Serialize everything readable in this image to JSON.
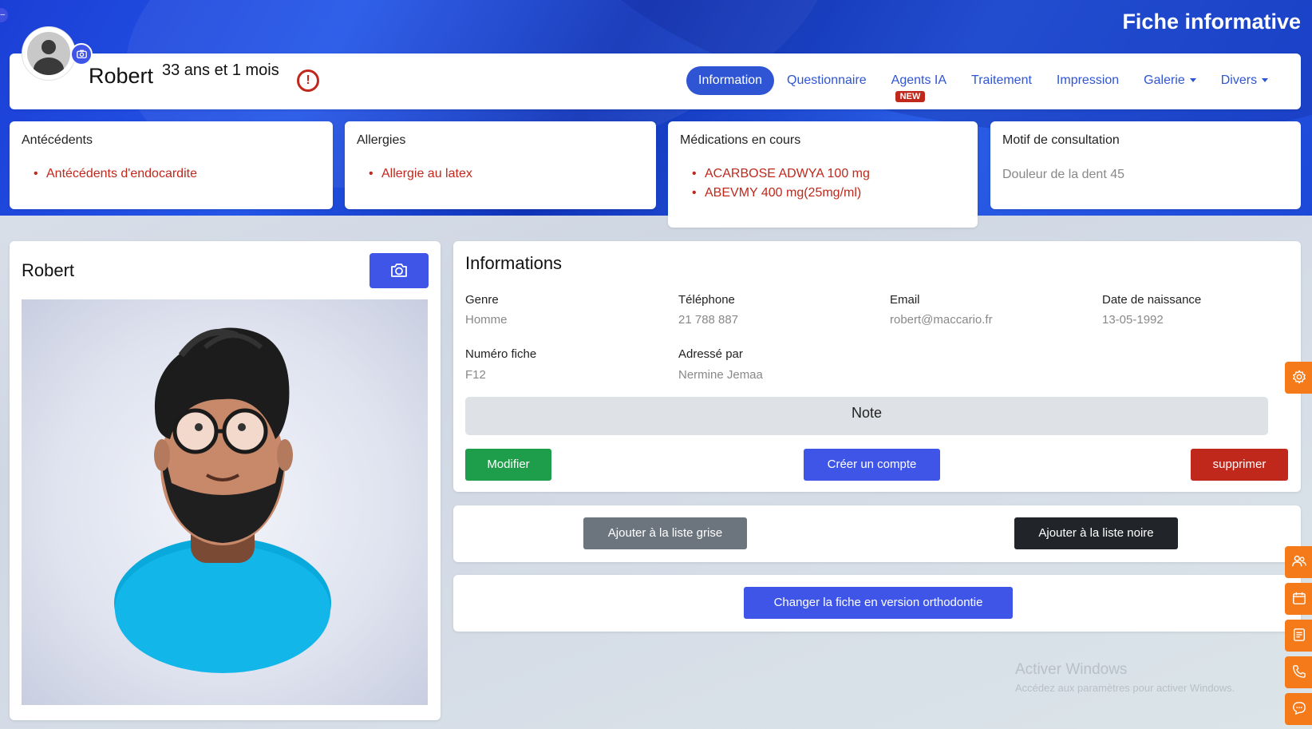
{
  "page": {
    "title": "Fiche informative"
  },
  "patient": {
    "name": "Robert",
    "age": "33 ans et 1 mois",
    "alert_symbol": "!"
  },
  "nav": {
    "items": [
      {
        "label": "Information",
        "active": true
      },
      {
        "label": "Questionnaire"
      },
      {
        "label": "Agents IA",
        "badge": "NEW"
      },
      {
        "label": "Traitement"
      },
      {
        "label": "Impression"
      },
      {
        "label": "Galerie",
        "dropdown": true
      },
      {
        "label": "Divers",
        "dropdown": true
      }
    ]
  },
  "summary": {
    "antecedents": {
      "title": "Antécédents",
      "items": [
        "Antécédents d'endocardite"
      ]
    },
    "allergies": {
      "title": "Allergies",
      "items": [
        "Allergie au latex"
      ]
    },
    "medications": {
      "title": "Médications en cours",
      "items": [
        "ACARBOSE ADWYA 100 mg",
        "ABEVMY 400 mg(25mg/ml)"
      ]
    },
    "motif": {
      "title": "Motif de consultation",
      "text": "Douleur de la dent 45"
    }
  },
  "photo_card": {
    "name": "Robert",
    "camera_icon": "camera-icon"
  },
  "info": {
    "title": "Informations",
    "fields": {
      "genre": {
        "label": "Genre",
        "value": "Homme"
      },
      "telephone": {
        "label": "Téléphone",
        "value": "21 788 887"
      },
      "email": {
        "label": "Email",
        "value": "robert@maccario.fr"
      },
      "naissance": {
        "label": "Date de naissance",
        "value": "13-05-1992"
      },
      "fiche": {
        "label": "Numéro fiche",
        "value": "F12"
      },
      "adresse": {
        "label": "Adressé par",
        "value": "Nermine Jemaa"
      }
    },
    "note_label": "Note",
    "buttons": {
      "modifier": "Modifier",
      "creer": "Créer un compte",
      "supprimer": "supprimer"
    }
  },
  "lists": {
    "grise": "Ajouter à la liste grise",
    "noire": "Ajouter à la liste noire"
  },
  "ortho": {
    "label": "Changer la fiche en version orthodontie"
  },
  "colors": {
    "primary": "#3e55e8",
    "danger": "#c0281c",
    "success": "#1e9e4a",
    "secondary": "#6c757d",
    "dark": "#212529",
    "side_tab": "#f57a1a"
  },
  "watermark": {
    "line1": "Activer Windows",
    "line2": "Accédez aux paramètres pour activer Windows."
  },
  "side_tabs": [
    "gear-icon",
    "users-icon",
    "calendar-icon",
    "document-icon",
    "phone-icon",
    "chat-icon"
  ]
}
